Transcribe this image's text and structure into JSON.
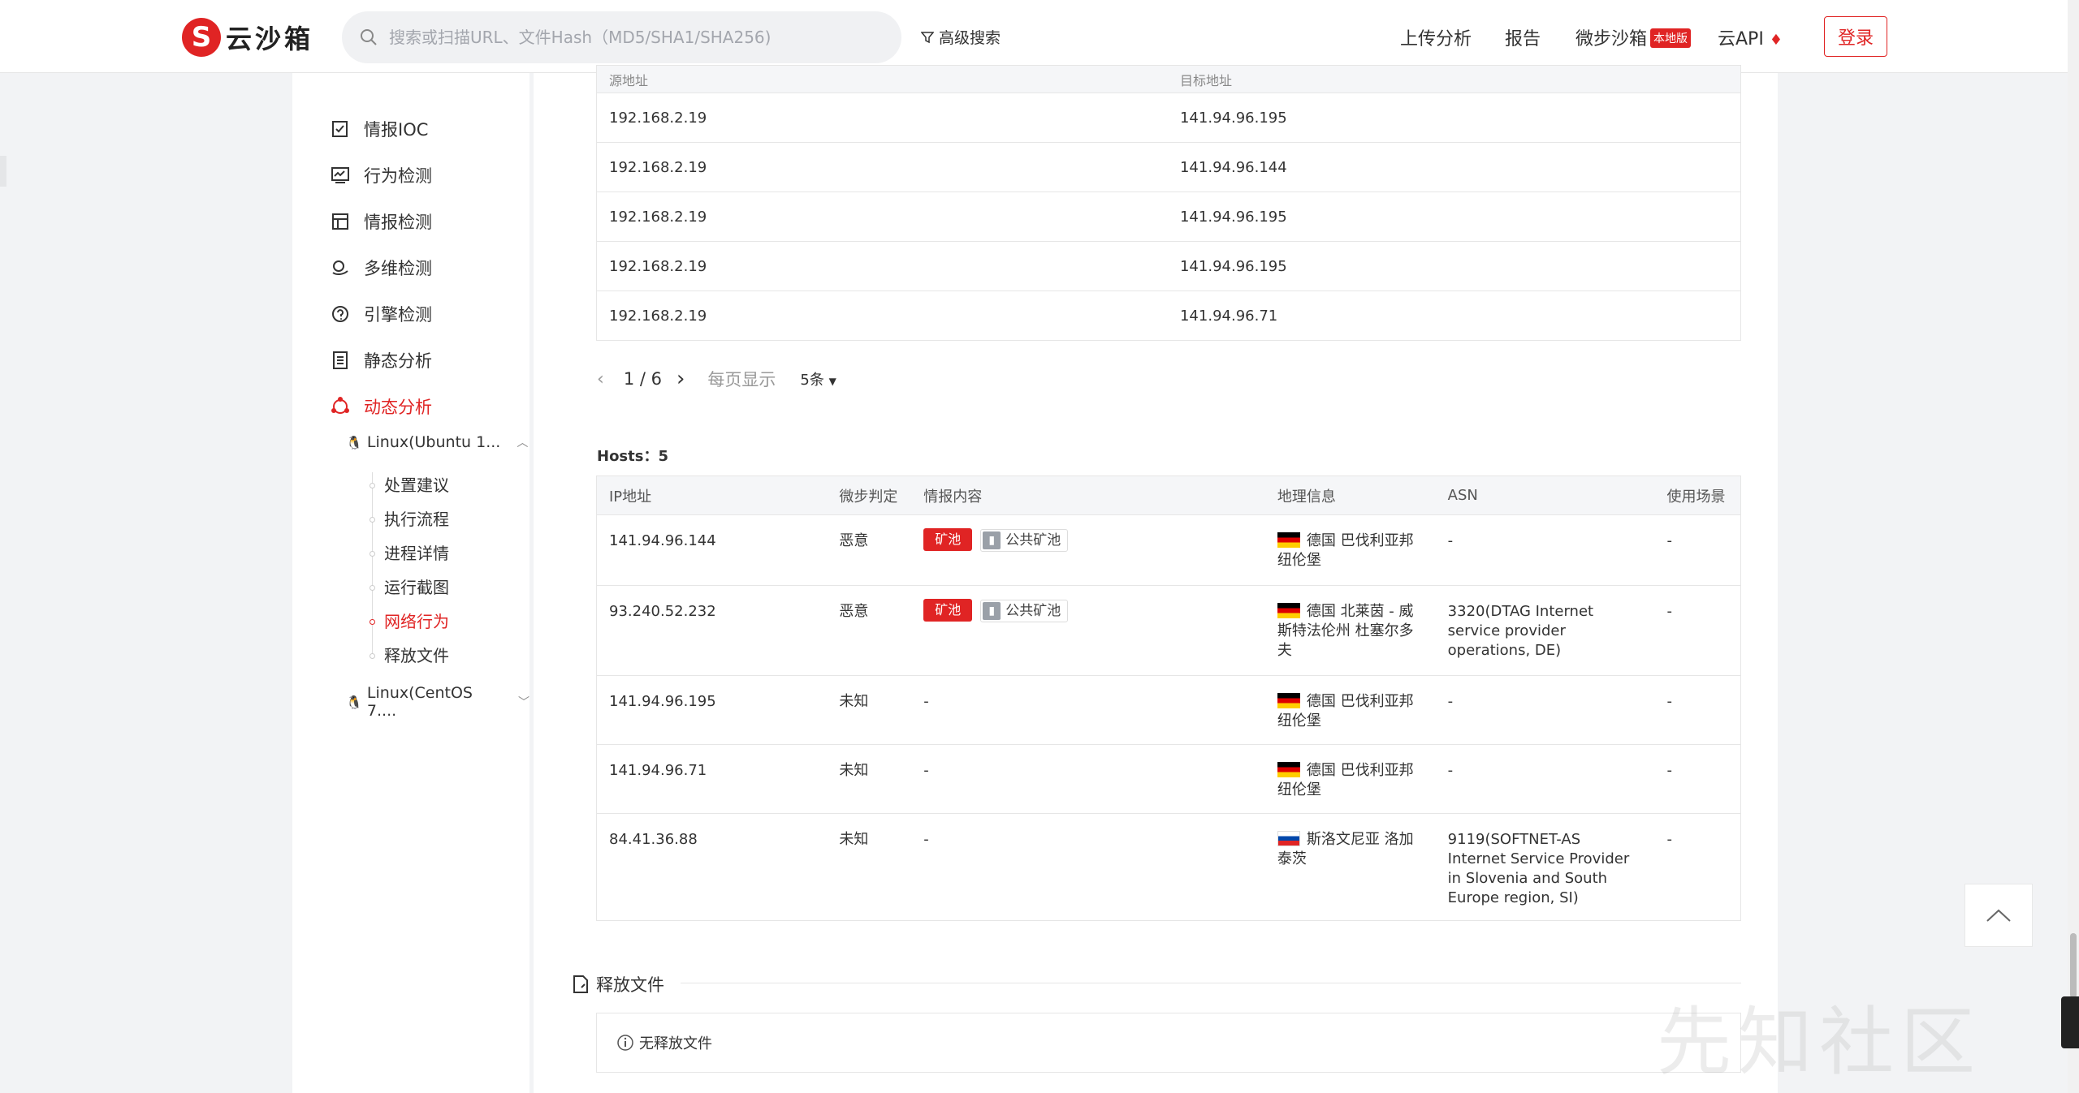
{
  "header": {
    "logo_mark": "S",
    "logo_text": "云沙箱",
    "search_placeholder": "搜索或扫描URL、文件Hash（MD5/SHA1/SHA256)",
    "advanced_search": "高级搜索",
    "nav": {
      "upload": "上传分析",
      "report": "报告",
      "sandbox": "微步沙箱",
      "sandbox_badge": "本地版",
      "api": "云API",
      "login": "登录"
    }
  },
  "sidebar": {
    "items": [
      {
        "label": "情报IOC",
        "icon": "ioc-icon"
      },
      {
        "label": "行为检测",
        "icon": "behavior-icon"
      },
      {
        "label": "情报检测",
        "icon": "intel-icon"
      },
      {
        "label": "多维检测",
        "icon": "multi-icon"
      },
      {
        "label": "引擎检测",
        "icon": "engine-icon"
      },
      {
        "label": "静态分析",
        "icon": "static-icon"
      },
      {
        "label": "动态分析",
        "icon": "dynamic-icon"
      }
    ],
    "os_1": "Linux(Ubuntu 1...",
    "os_2": "Linux(CentOS 7....",
    "sub_items": [
      "处置建议",
      "执行流程",
      "进程详情",
      "运行截图",
      "网络行为",
      "释放文件"
    ]
  },
  "connections": {
    "headers": [
      "源地址",
      "目标地址"
    ],
    "rows": [
      [
        "192.168.2.19",
        "141.94.96.195"
      ],
      [
        "192.168.2.19",
        "141.94.96.144"
      ],
      [
        "192.168.2.19",
        "141.94.96.195"
      ],
      [
        "192.168.2.19",
        "141.94.96.195"
      ],
      [
        "192.168.2.19",
        "141.94.96.71"
      ]
    ],
    "pager": {
      "page": "1 / 6",
      "per_page_label": "每页显示",
      "per_page": "5条"
    }
  },
  "hosts": {
    "title": "Hosts：5",
    "headers": [
      "IP地址",
      "微步判定",
      "情报内容",
      "地理信息",
      "ASN",
      "使用场景"
    ],
    "rows": [
      {
        "ip": "141.94.96.144",
        "verdict": "恶意",
        "tag": "矿池",
        "tag2": "公共矿池",
        "geo": "德国 巴伐利亚邦纽伦堡",
        "flag": "de",
        "asn": "-",
        "scene": "-"
      },
      {
        "ip": "93.240.52.232",
        "verdict": "恶意",
        "tag": "矿池",
        "tag2": "公共矿池",
        "geo": "德国 北莱茵 - 威斯特法伦州 杜塞尔多夫",
        "flag": "de",
        "asn": "3320(DTAG Internet service provider operations, DE)",
        "scene": "-"
      },
      {
        "ip": "141.94.96.195",
        "verdict": "未知",
        "intel": "-",
        "geo": "德国 巴伐利亚邦纽伦堡",
        "flag": "de",
        "asn": "-",
        "scene": "-"
      },
      {
        "ip": "141.94.96.71",
        "verdict": "未知",
        "intel": "-",
        "geo": "德国 巴伐利亚邦纽伦堡",
        "flag": "de",
        "asn": "-",
        "scene": "-"
      },
      {
        "ip": "84.41.36.88",
        "verdict": "未知",
        "intel": "-",
        "geo": "斯洛文尼亚 洛加泰茨",
        "flag": "si",
        "asn": "9119(SOFTNET-AS Internet Service Provider in Slovenia and South Europe region, SI)",
        "scene": "-"
      }
    ]
  },
  "release": {
    "title": "释放文件",
    "empty": "无释放文件"
  },
  "watermark": "先知社区",
  "colors": {
    "brand_red": "#e02424"
  }
}
